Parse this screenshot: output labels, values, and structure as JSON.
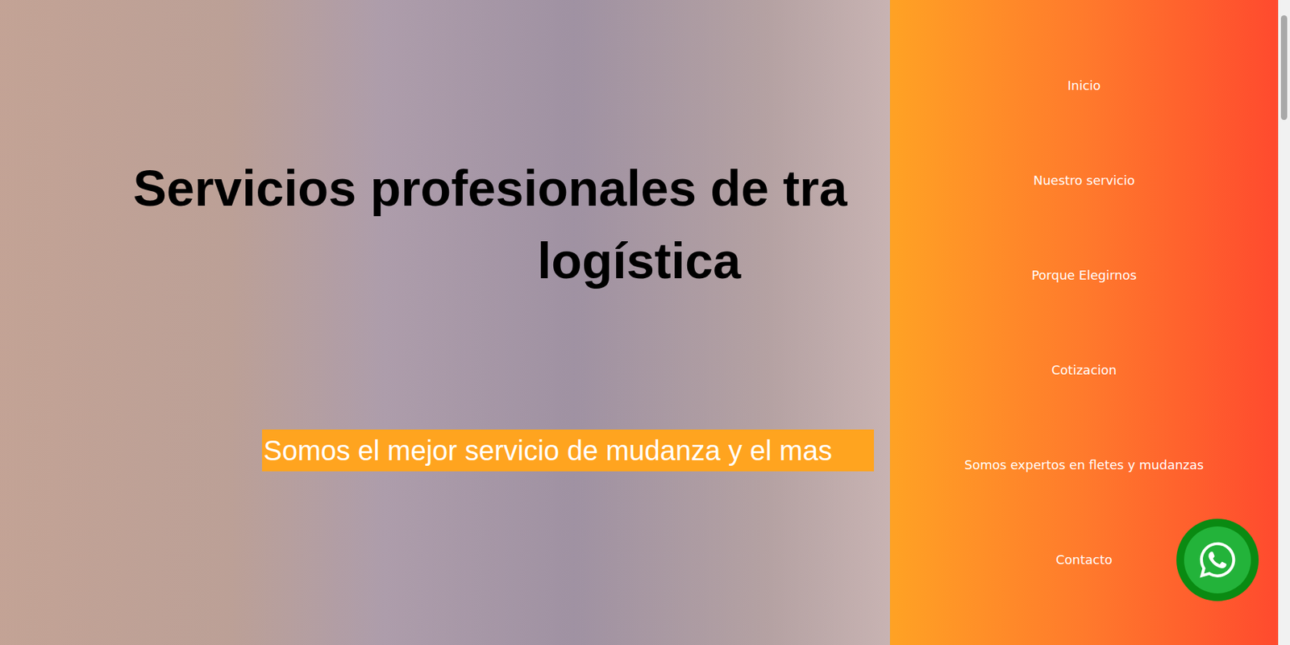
{
  "hero": {
    "title_lines": [
      "Servicios profesionales de tra",
      "logística"
    ],
    "subtitle": "Somos el mejor servicio de mudanza y el mas"
  },
  "side_menu": {
    "items": [
      {
        "label": "Inicio"
      },
      {
        "label": "Nuestro servicio"
      },
      {
        "label": "Porque Elegirnos"
      },
      {
        "label": "Cotizacion"
      },
      {
        "label": "Somos expertos en fletes y mudanzas"
      },
      {
        "label": "Contacto"
      }
    ]
  }
}
